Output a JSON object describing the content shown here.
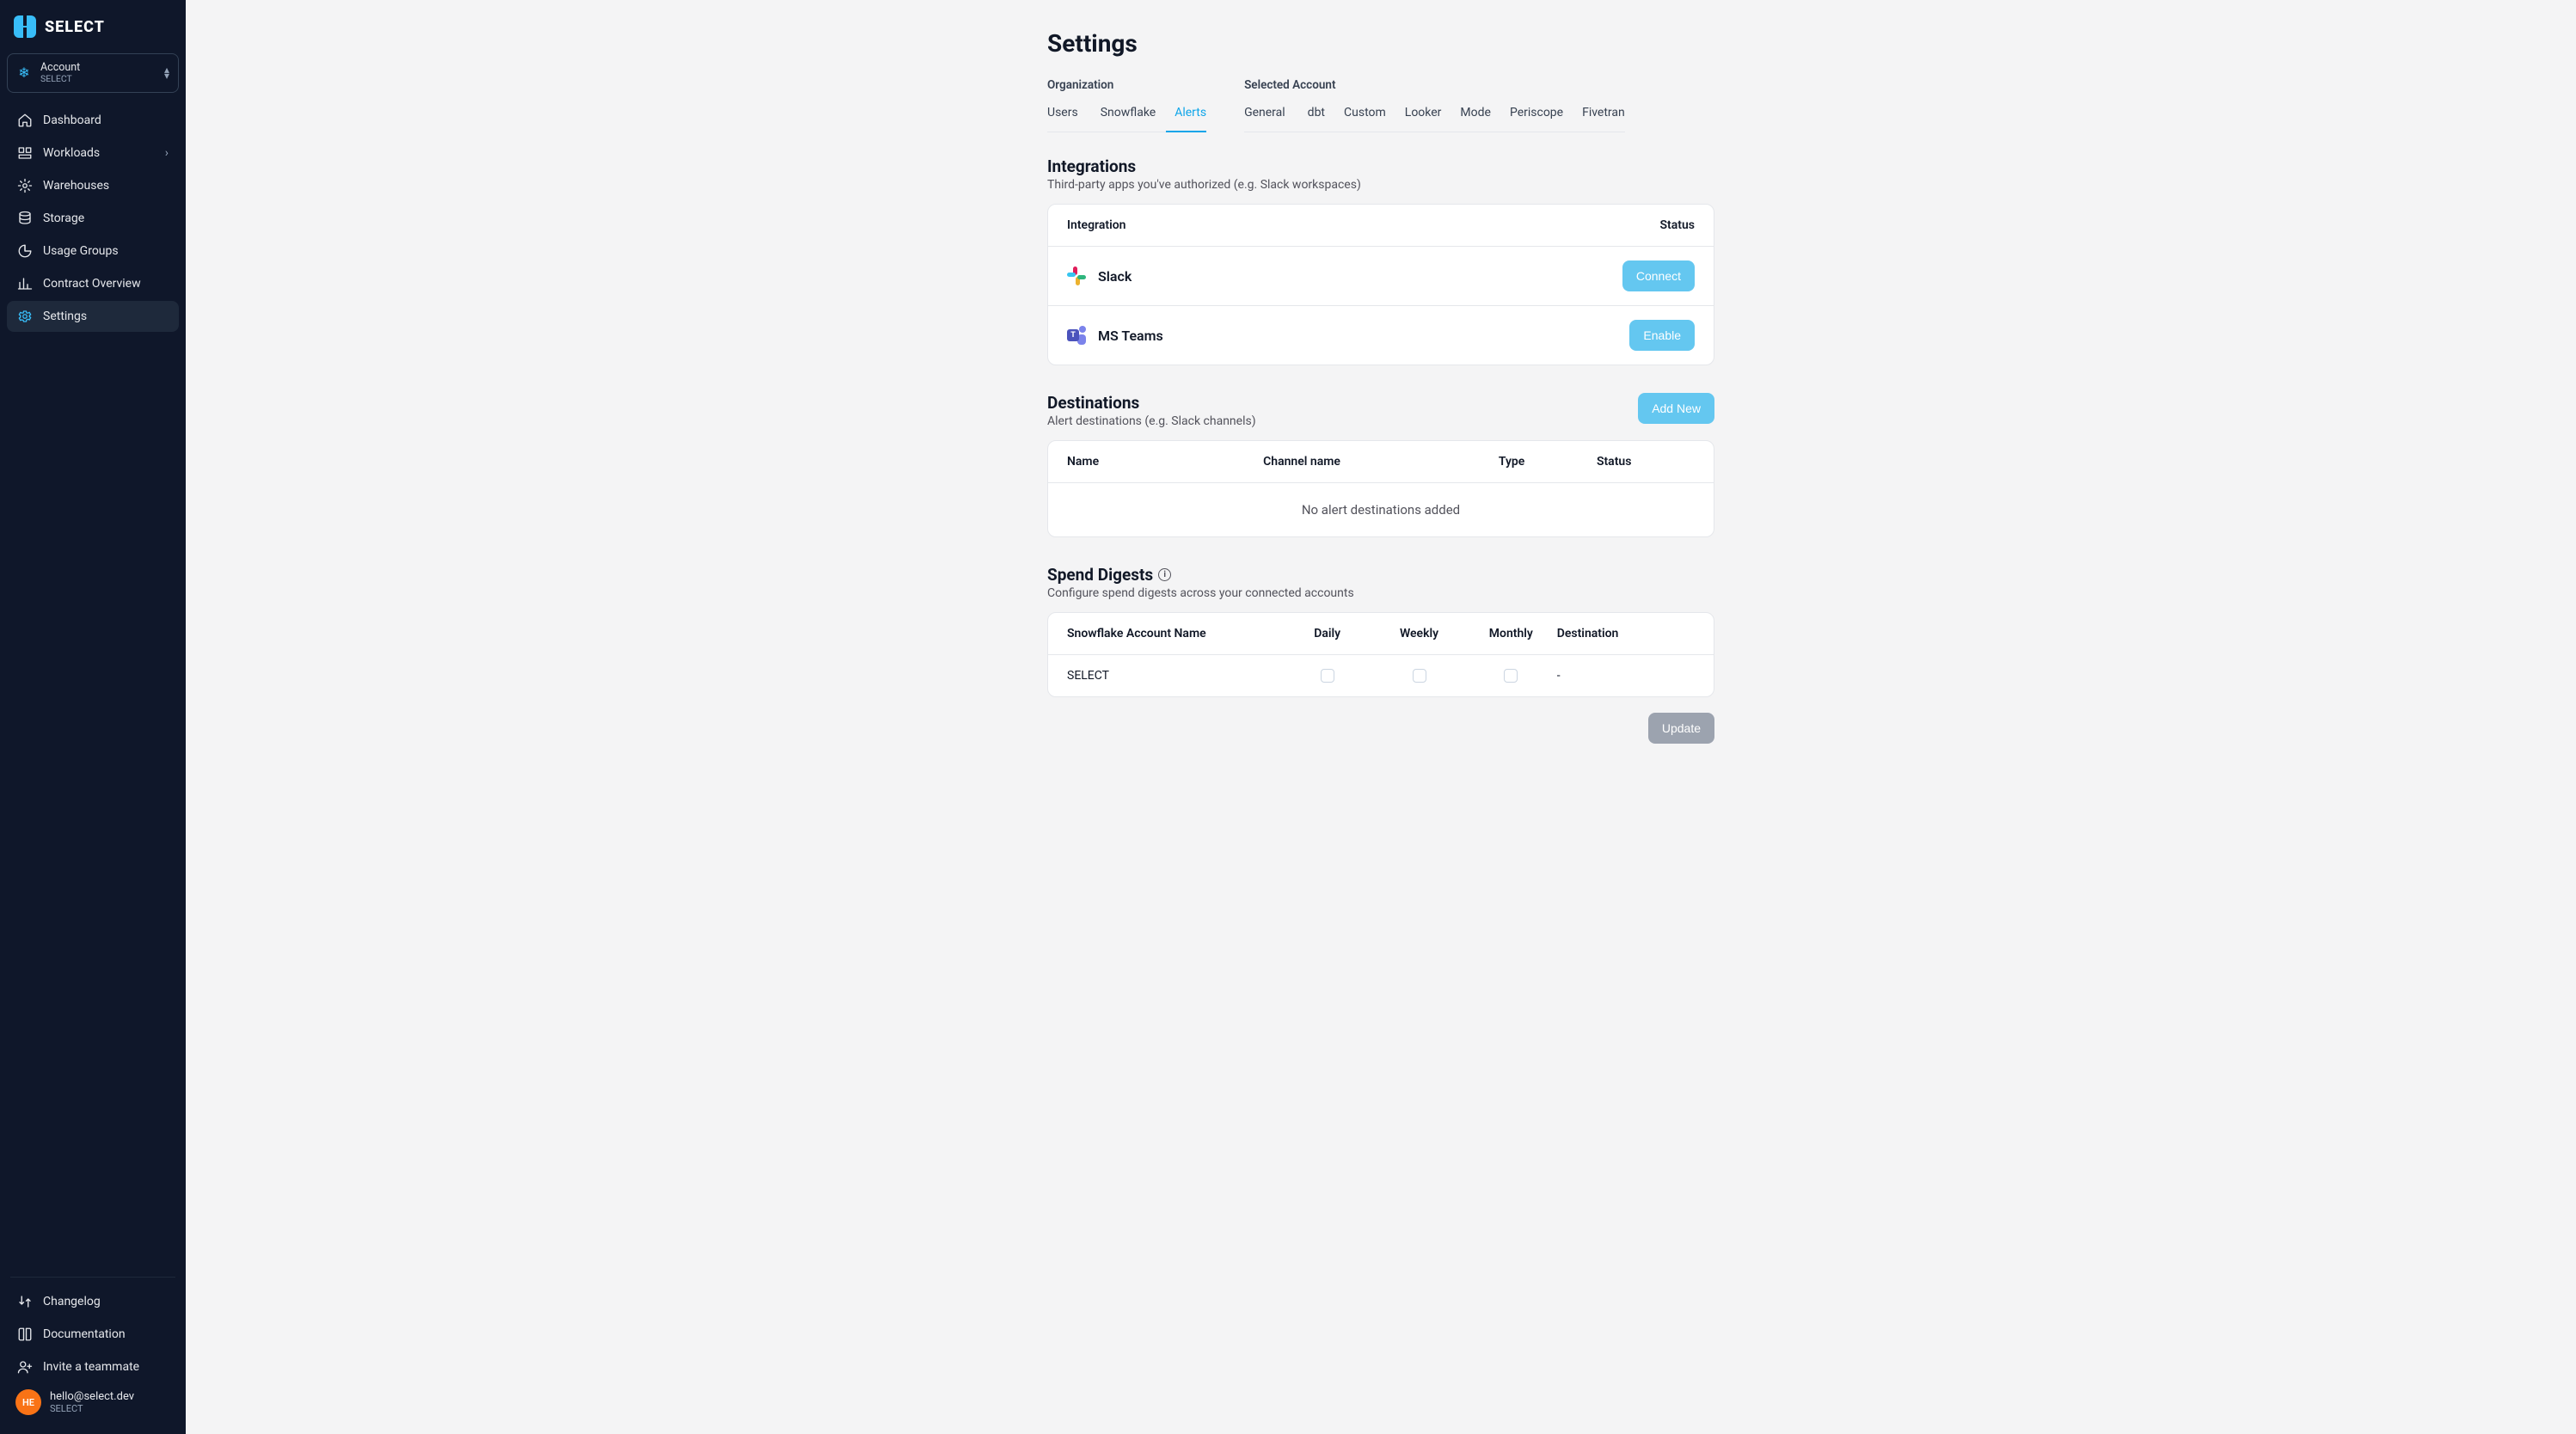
{
  "brand": "SELECT",
  "account_selector": {
    "label": "Account",
    "value": "SELECT"
  },
  "sidebar": {
    "items": [
      {
        "label": "Dashboard"
      },
      {
        "label": "Workloads"
      },
      {
        "label": "Warehouses"
      },
      {
        "label": "Storage"
      },
      {
        "label": "Usage Groups"
      },
      {
        "label": "Contract Overview"
      },
      {
        "label": "Settings"
      }
    ],
    "footer_items": [
      {
        "label": "Changelog"
      },
      {
        "label": "Documentation"
      },
      {
        "label": "Invite a teammate"
      }
    ]
  },
  "user": {
    "initials": "HE",
    "email": "hello@select.dev",
    "org": "SELECT"
  },
  "page": {
    "title": "Settings",
    "tab_groups": {
      "organization": {
        "label": "Organization",
        "tabs": [
          "Users",
          "Snowflake",
          "Alerts"
        ]
      },
      "selected_account": {
        "label": "Selected Account",
        "tabs": [
          "General",
          "dbt",
          "Custom",
          "Looker",
          "Mode",
          "Periscope",
          "Fivetran"
        ]
      }
    },
    "integrations": {
      "title": "Integrations",
      "subtitle": "Third-party apps you've authorized (e.g. Slack workspaces)",
      "header_integration": "Integration",
      "header_status": "Status",
      "rows": [
        {
          "name": "Slack",
          "action": "Connect"
        },
        {
          "name": "MS Teams",
          "action": "Enable"
        }
      ]
    },
    "destinations": {
      "title": "Destinations",
      "subtitle": "Alert destinations (e.g. Slack channels)",
      "add_button": "Add New",
      "cols": {
        "name": "Name",
        "channel": "Channel name",
        "type": "Type",
        "status": "Status"
      },
      "empty": "No alert destinations added"
    },
    "spend_digests": {
      "title": "Spend Digests",
      "subtitle": "Configure spend digests across your connected accounts",
      "cols": {
        "name": "Snowflake Account Name",
        "daily": "Daily",
        "weekly": "Weekly",
        "monthly": "Monthly",
        "destination": "Destination"
      },
      "rows": [
        {
          "name": "SELECT",
          "daily": false,
          "weekly": false,
          "monthly": false,
          "destination": "-"
        }
      ],
      "update": "Update"
    }
  }
}
